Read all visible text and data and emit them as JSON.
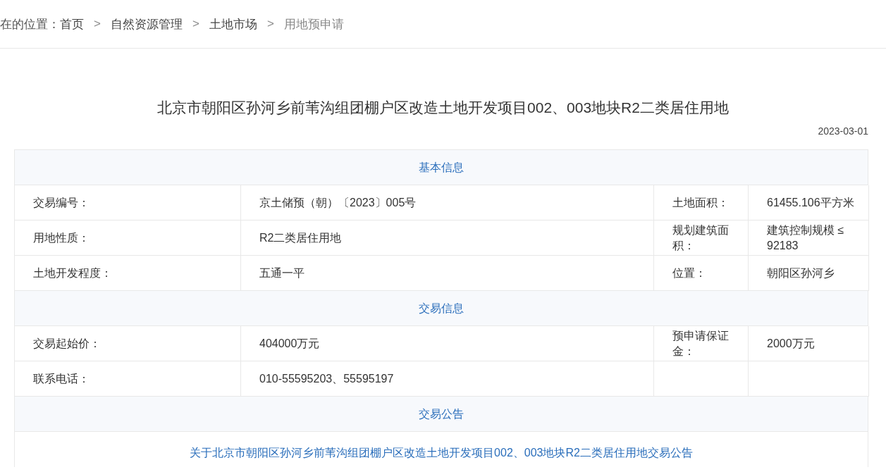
{
  "breadcrumb": {
    "prefix": "在的位置：",
    "separator": ">",
    "items": [
      {
        "label": "首页",
        "current": false
      },
      {
        "label": "自然资源管理",
        "current": false
      },
      {
        "label": "土地市场",
        "current": false
      },
      {
        "label": "用地预申请",
        "current": true
      }
    ]
  },
  "title": "北京市朝阳区孙河乡前苇沟组团棚户区改造土地开发项目002、003地块R2二类居住用地",
  "date": "2023-03-01",
  "sections": [
    {
      "heading": "基本信息",
      "rows": [
        {
          "label_1": "交易编号：",
          "value_1": "京土储预（朝）〔2023〕005号",
          "label_2": "土地面积：",
          "value_2": "61455.106平方米"
        },
        {
          "label_1": "用地性质：",
          "value_1": "R2二类居住用地",
          "label_2": "规划建筑面积：",
          "value_2": "建筑控制规模 ≤ 92183"
        },
        {
          "label_1": "土地开发程度：",
          "value_1": "五通一平",
          "label_2": "位置：",
          "value_2": "朝阳区孙河乡"
        }
      ]
    },
    {
      "heading": "交易信息",
      "rows": [
        {
          "label_1": "交易起始价：",
          "value_1": "404000万元",
          "label_2": "预申请保证金：",
          "value_2": "2000万元"
        },
        {
          "label_1": "联系电话：",
          "value_1": "010-55595203、55595197"
        }
      ]
    },
    {
      "heading": "交易公告",
      "link": "关于北京市朝阳区孙河乡前苇沟组团棚户区改造土地开发项目002、003地块R2二类居住用地交易公告"
    }
  ]
}
